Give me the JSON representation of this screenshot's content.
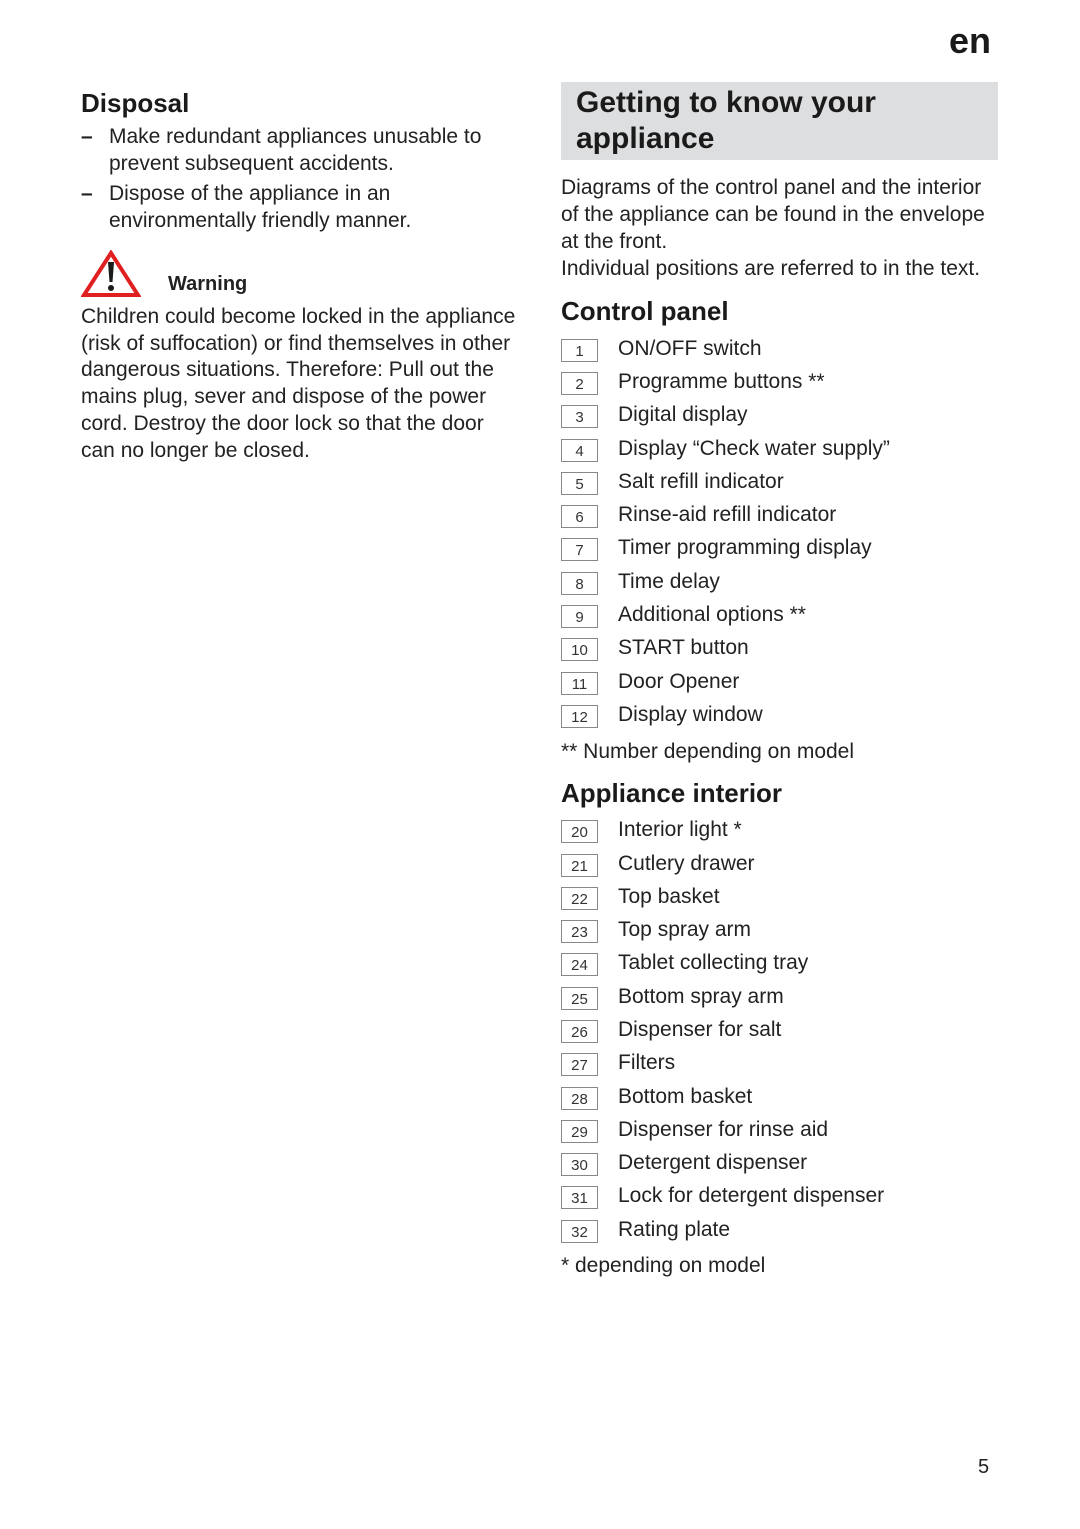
{
  "header": {
    "language": "en"
  },
  "disposal": {
    "title": "Disposal",
    "items": [
      "Make redundant appliances unusable to prevent subsequent accidents.",
      "Dispose of the appliance in an environmentally friendly manner."
    ],
    "warning_label": "Warning",
    "warning_text": "Children could become locked in the appliance (risk of suffocation) or find themselves in other dangerous situations. Therefore: Pull out the mains plug, sever and dispose of the power cord. Destroy the door lock so that the door can no longer be closed."
  },
  "getting_to_know": {
    "title": "Getting to know your appliance",
    "intro1": "Diagrams of the control panel and the interior of the appliance can be found in the envelope at the front.",
    "intro2": "Individual positions are referred to in the text."
  },
  "control_panel": {
    "title": "Control panel",
    "items": [
      {
        "num": "1",
        "label": "ON/OFF switch"
      },
      {
        "num": "2",
        "label": "Programme buttons **"
      },
      {
        "num": "3",
        "label": "Digital display"
      },
      {
        "num": "4",
        "label": "Display “Check water supply”"
      },
      {
        "num": "5",
        "label": "Salt refill indicator"
      },
      {
        "num": "6",
        "label": "Rinse-aid refill indicator"
      },
      {
        "num": "7",
        "label": "Timer programming display"
      },
      {
        "num": "8",
        "label": "Time delay"
      },
      {
        "num": "9",
        "label": "Additional options **"
      },
      {
        "num": "10",
        "label": "START button"
      },
      {
        "num": "11",
        "label": "Door Opener"
      },
      {
        "num": "12",
        "label": "Display window"
      }
    ],
    "note": "**  Number depending on model"
  },
  "appliance_interior": {
    "title": "Appliance interior",
    "items": [
      {
        "num": "20",
        "label": "Interior light *"
      },
      {
        "num": "21",
        "label": "Cutlery drawer"
      },
      {
        "num": "22",
        "label": "Top basket"
      },
      {
        "num": "23",
        "label": "Top spray arm"
      },
      {
        "num": "24",
        "label": "Tablet collecting tray"
      },
      {
        "num": "25",
        "label": "Bottom spray arm"
      },
      {
        "num": "26",
        "label": "Dispenser for salt"
      },
      {
        "num": "27",
        "label": "Filters"
      },
      {
        "num": "28",
        "label": "Bottom basket"
      },
      {
        "num": "29",
        "label": "Dispenser for rinse aid"
      },
      {
        "num": "30",
        "label": "Detergent dispenser"
      },
      {
        "num": "31",
        "label": "Lock for detergent dispenser"
      },
      {
        "num": "32",
        "label": "Rating plate"
      }
    ],
    "note": "* depending on model"
  },
  "footer": {
    "page_number": "5"
  },
  "colors": {
    "warning_red": "#e02020",
    "heading_bg": "#dddedf"
  }
}
